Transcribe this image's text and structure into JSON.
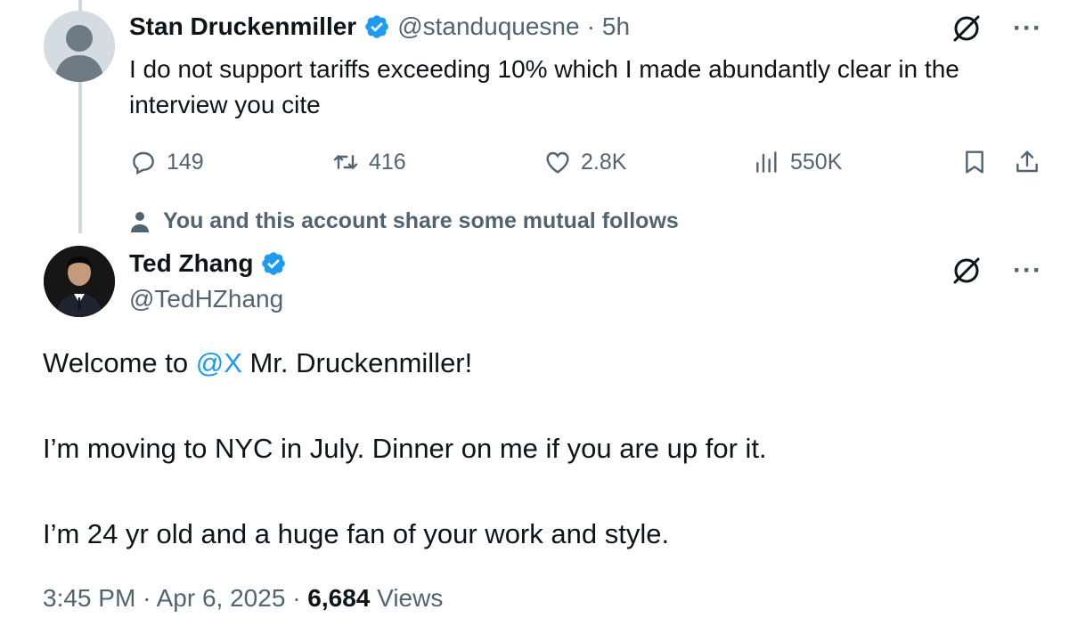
{
  "reply_tweet": {
    "name": "Stan Druckenmiller",
    "handle": "@standuquesne",
    "separator": "·",
    "time": "5h",
    "text": "I do not support tariffs exceeding 10% which I made abundantly clear in the interview you cite",
    "stats": {
      "replies": "149",
      "reposts": "416",
      "likes": "2.8K",
      "views": "550K"
    }
  },
  "mutual_notice": "You and this account share some mutual follows",
  "main_tweet": {
    "name": "Ted Zhang",
    "handle": "@TedHZhang",
    "text_prefix": "Welcome to ",
    "mention": "@X",
    "text_suffix": " Mr. Druckenmiller!",
    "paragraph2": "I’m moving to NYC in July. Dinner on me if you are up for it.",
    "paragraph3": "I’m 24 yr old and a huge fan of your work and style.",
    "time": "3:45 PM",
    "date": "Apr 6, 2025",
    "views_count": "6,684",
    "views_label": "Views"
  },
  "more_menu": "···",
  "colors": {
    "accent": "#1d9bf0",
    "muted": "#536471",
    "text": "#0f1419",
    "thread_line": "#cfd9de"
  },
  "icons": [
    "reply-icon",
    "repost-icon",
    "like-icon",
    "views-icon",
    "bookmark-icon",
    "share-icon",
    "grok-icon",
    "more-icon",
    "verified-icon",
    "person-icon"
  ]
}
